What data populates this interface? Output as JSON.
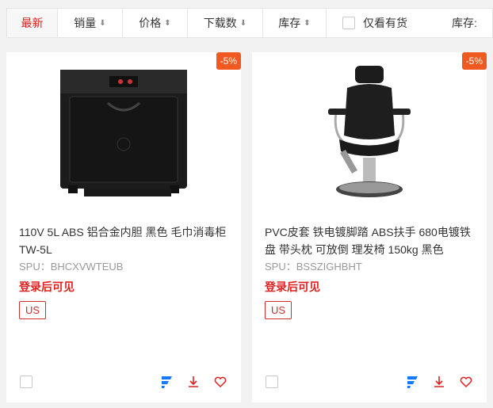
{
  "sortbar": {
    "latest": "最新",
    "sales": "销量",
    "price": "价格",
    "downloads": "下载数",
    "stock": "库存",
    "only_in_stock": "仅看有货",
    "stock_label": "库存:"
  },
  "products": [
    {
      "discount": "-5%",
      "title": "110V 5L ABS 铝合金内胆 黑色 毛巾消毒柜 TW-5L",
      "spu": "SPU：BHCXVWTEUB",
      "login_prompt": "登录后可见",
      "tag": "US"
    },
    {
      "discount": "-5%",
      "title": "PVC皮套 铁电镀脚踏 ABS扶手 680电镀铁盘 带头枕 可放倒 理发椅 150kg 黑色",
      "spu": "SPU：BSSZIGHBHT",
      "login_prompt": "登录后可见",
      "tag": "US"
    }
  ],
  "colors": {
    "accent": "#e02020",
    "badge": "#f05a22",
    "brand_blue": "#1677ff"
  }
}
